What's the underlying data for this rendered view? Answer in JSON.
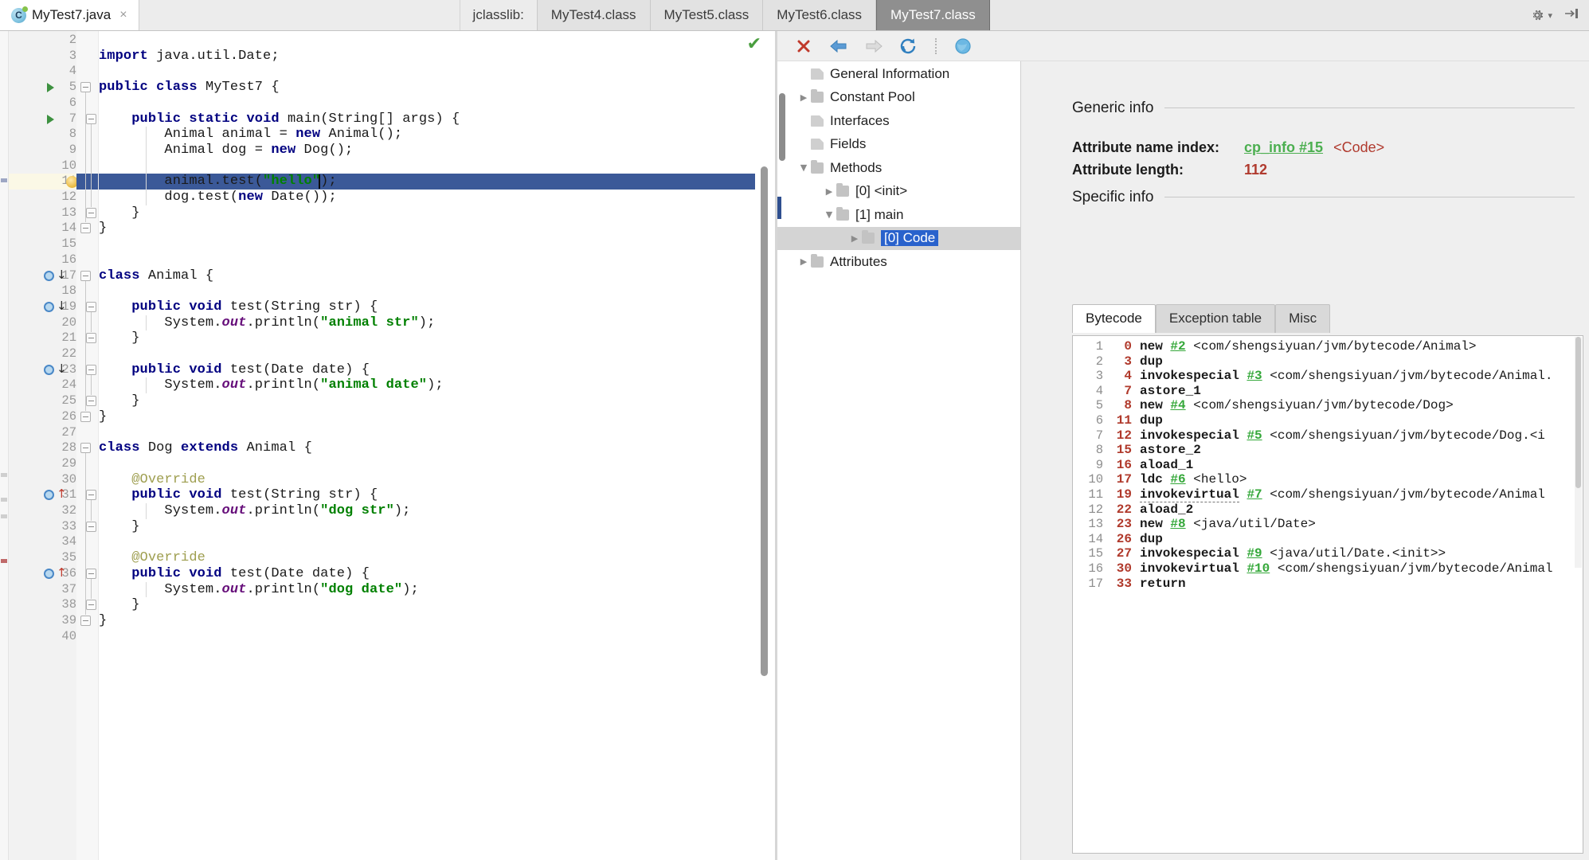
{
  "window": {
    "editor_tab": {
      "label": "MyTest7.java",
      "icon": "java-class-icon",
      "close": "×"
    },
    "jclasslib_label": "jclasslib:",
    "class_tabs": [
      {
        "label": "MyTest4.class",
        "active": false
      },
      {
        "label": "MyTest5.class",
        "active": false
      },
      {
        "label": "MyTest6.class",
        "active": false
      },
      {
        "label": "MyTest7.class",
        "active": true
      }
    ],
    "settings_icon": "gear-icon",
    "settings_caret": "▾",
    "hide_icon": "hide-panel-icon"
  },
  "editor": {
    "status_check": "✔",
    "lines": [
      {
        "n": 2,
        "text": ""
      },
      {
        "n": 3,
        "text": "import java.util.Date;",
        "tokens": [
          [
            "kw",
            "import"
          ],
          [
            "plain",
            " java.util.Date;"
          ]
        ]
      },
      {
        "n": 4,
        "text": ""
      },
      {
        "n": 5,
        "text": "public class MyTest7 {",
        "tokens": [
          [
            "kw",
            "public class"
          ],
          [
            "plain",
            " MyTest7 {"
          ]
        ]
      },
      {
        "n": 6,
        "text": ""
      },
      {
        "n": 7,
        "text": "    public static void main(String[] args) {"
      },
      {
        "n": 8,
        "text": "        Animal animal = new Animal();"
      },
      {
        "n": 9,
        "text": "        Animal dog = new Dog();"
      },
      {
        "n": 10,
        "text": ""
      },
      {
        "n": 11,
        "text": "        animal.test(\"hello\");",
        "highlighted": true
      },
      {
        "n": 12,
        "text": "        dog.test(new Date());"
      },
      {
        "n": 13,
        "text": "    }"
      },
      {
        "n": 14,
        "text": "}"
      },
      {
        "n": 15,
        "text": ""
      },
      {
        "n": 16,
        "text": ""
      },
      {
        "n": 17,
        "text": "class Animal {"
      },
      {
        "n": 18,
        "text": ""
      },
      {
        "n": 19,
        "text": "    public void test(String str) {"
      },
      {
        "n": 20,
        "text": "        System.out.println(\"animal str\");"
      },
      {
        "n": 21,
        "text": "    }"
      },
      {
        "n": 22,
        "text": ""
      },
      {
        "n": 23,
        "text": "    public void test(Date date) {"
      },
      {
        "n": 24,
        "text": "        System.out.println(\"animal date\");"
      },
      {
        "n": 25,
        "text": "    }"
      },
      {
        "n": 26,
        "text": "}"
      },
      {
        "n": 27,
        "text": ""
      },
      {
        "n": 28,
        "text": "class Dog extends Animal {"
      },
      {
        "n": 29,
        "text": ""
      },
      {
        "n": 30,
        "text": "    @Override"
      },
      {
        "n": 31,
        "text": "    public void test(String str) {"
      },
      {
        "n": 32,
        "text": "        System.out.println(\"dog str\");"
      },
      {
        "n": 33,
        "text": "    }"
      },
      {
        "n": 34,
        "text": ""
      },
      {
        "n": 35,
        "text": "    @Override"
      },
      {
        "n": 36,
        "text": "    public void test(Date date) {"
      },
      {
        "n": 37,
        "text": "        System.out.println(\"dog date\");"
      },
      {
        "n": 38,
        "text": "    }"
      },
      {
        "n": 39,
        "text": "}"
      },
      {
        "n": 40,
        "text": ""
      }
    ],
    "gutter": {
      "run_arrows": [
        5,
        7
      ],
      "override_down": [
        17,
        19,
        23
      ],
      "override_up": [
        31,
        36
      ],
      "bulb_line": 11
    }
  },
  "jclasslib": {
    "toolbar": [
      {
        "name": "close-icon",
        "glyph": "✕",
        "color": "#c0392b"
      },
      {
        "name": "back-icon",
        "glyph": "⇦",
        "color": "#5b9bd5"
      },
      {
        "name": "forward-icon",
        "glyph": "⇨",
        "color": "#c9c9c9"
      },
      {
        "name": "reload-icon",
        "glyph": "↺",
        "color": "#2f7fbf"
      },
      {
        "name": "browse-icon",
        "glyph": "●",
        "color": "#5aa9dd"
      }
    ],
    "tree": [
      {
        "label": "General Information",
        "indent": 0,
        "twist": "",
        "icon": "doc",
        "selected": false
      },
      {
        "label": "Constant Pool",
        "indent": 0,
        "twist": "▶",
        "icon": "folder",
        "selected": false
      },
      {
        "label": "Interfaces",
        "indent": 0,
        "twist": "",
        "icon": "doc",
        "selected": false
      },
      {
        "label": "Fields",
        "indent": 0,
        "twist": "",
        "icon": "doc",
        "selected": false
      },
      {
        "label": "Methods",
        "indent": 0,
        "twist": "▼",
        "icon": "folder",
        "selected": false
      },
      {
        "label": "[0] <init>",
        "indent": 1,
        "twist": "▶",
        "icon": "folder",
        "selected": false
      },
      {
        "label": "[1] main",
        "indent": 1,
        "twist": "▼",
        "icon": "folder",
        "selected": false
      },
      {
        "label": "[0] Code",
        "indent": 2,
        "twist": "▶",
        "icon": "folder",
        "selected": true
      },
      {
        "label": "Attributes",
        "indent": 0,
        "twist": "▶",
        "icon": "folder",
        "selected": false
      }
    ],
    "generic_info": {
      "title": "Generic info",
      "rows": [
        {
          "label": "Attribute name index:",
          "link": "cp_info #15",
          "suffix": "<Code>"
        },
        {
          "label": "Attribute length:",
          "value": "112"
        }
      ]
    },
    "specific_info": {
      "title": "Specific info",
      "tabs": [
        {
          "label": "Bytecode",
          "active": true
        },
        {
          "label": "Exception table",
          "active": false
        },
        {
          "label": "Misc",
          "active": false
        }
      ]
    },
    "bytecode": [
      {
        "line": 1,
        "offset": "0",
        "mnemonic": "new",
        "cp": "#2",
        "desc": "<com/shengsiyuan/jvm/bytecode/Animal>"
      },
      {
        "line": 2,
        "offset": "3",
        "mnemonic": "dup",
        "cp": "",
        "desc": ""
      },
      {
        "line": 3,
        "offset": "4",
        "mnemonic": "invokespecial",
        "cp": "#3",
        "desc": "<com/shengsiyuan/jvm/bytecode/Animal."
      },
      {
        "line": 4,
        "offset": "7",
        "mnemonic": "astore_1",
        "cp": "",
        "desc": ""
      },
      {
        "line": 5,
        "offset": "8",
        "mnemonic": "new",
        "cp": "#4",
        "desc": "<com/shengsiyuan/jvm/bytecode/Dog>"
      },
      {
        "line": 6,
        "offset": "11",
        "mnemonic": "dup",
        "cp": "",
        "desc": ""
      },
      {
        "line": 7,
        "offset": "12",
        "mnemonic": "invokespecial",
        "cp": "#5",
        "desc": "<com/shengsiyuan/jvm/bytecode/Dog.<i"
      },
      {
        "line": 8,
        "offset": "15",
        "mnemonic": "astore_2",
        "cp": "",
        "desc": ""
      },
      {
        "line": 9,
        "offset": "16",
        "mnemonic": "aload_1",
        "cp": "",
        "desc": ""
      },
      {
        "line": 10,
        "offset": "17",
        "mnemonic": "ldc",
        "cp": "#6",
        "desc": "<hello>"
      },
      {
        "line": 11,
        "offset": "19",
        "mnemonic": "invokevirtual",
        "cp": "#7",
        "desc": "<com/shengsiyuan/jvm/bytecode/Animal",
        "hover": true
      },
      {
        "line": 12,
        "offset": "22",
        "mnemonic": "aload_2",
        "cp": "",
        "desc": ""
      },
      {
        "line": 13,
        "offset": "23",
        "mnemonic": "new",
        "cp": "#8",
        "desc": "<java/util/Date>"
      },
      {
        "line": 14,
        "offset": "26",
        "mnemonic": "dup",
        "cp": "",
        "desc": ""
      },
      {
        "line": 15,
        "offset": "27",
        "mnemonic": "invokespecial",
        "cp": "#9",
        "desc": "<java/util/Date.<init>>"
      },
      {
        "line": 16,
        "offset": "30",
        "mnemonic": "invokevirtual",
        "cp": "#10",
        "desc": "<com/shengsiyuan/jvm/bytecode/Animal"
      },
      {
        "line": 17,
        "offset": "33",
        "mnemonic": "return",
        "cp": "",
        "desc": ""
      }
    ]
  },
  "colors": {
    "selection_blue": "#3b5998",
    "tree_select_blue": "#2962cc",
    "link_green": "#4caf50",
    "value_red": "#b03a2e",
    "keyword_navy": "#000080",
    "string_green": "#008000"
  }
}
